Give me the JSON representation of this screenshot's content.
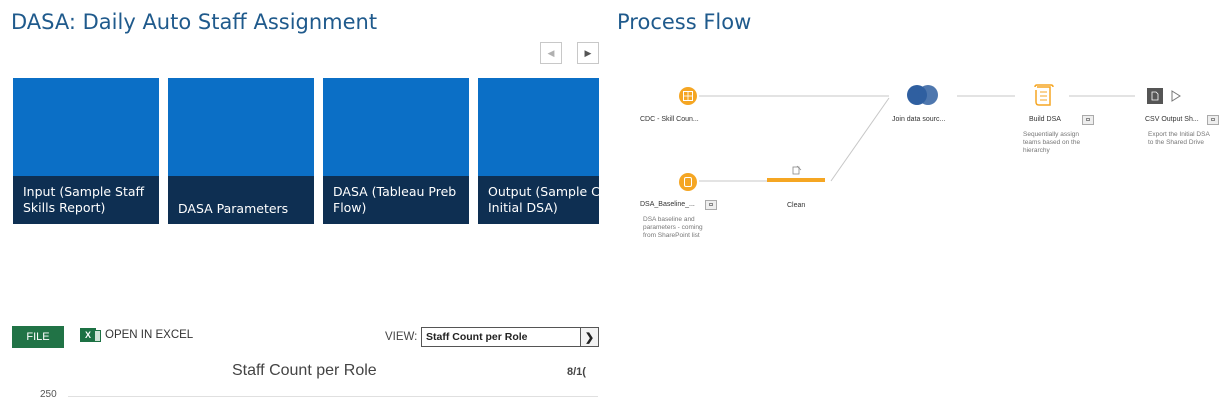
{
  "dasa": {
    "title": "DASA: Daily Auto Staff Assignment",
    "nav": {
      "prev_icon": "chevron-left-icon",
      "next_icon": "chevron-right-icon"
    },
    "tiles": [
      {
        "label": "Input (Sample Staff\nSkills Report)"
      },
      {
        "label": "DASA Parameters"
      },
      {
        "label": "DASA (Tableau Preb\nFlow)"
      },
      {
        "label": "Output (Sample CDC\nInitial DSA)"
      }
    ],
    "colors": {
      "tile": "#0b6fc6",
      "caption": "#0e2f52",
      "title": "#1f5a8c"
    }
  },
  "excel": {
    "file_label": "FILE",
    "open_label": "OPEN IN EXCEL",
    "view_label": "VIEW:",
    "view_selected": "Staff Count per Role",
    "chart_title": "Staff Count per Role",
    "date_text": "8/1(",
    "y_tick": "250",
    "colors": {
      "file": "#217346"
    }
  },
  "process_flow": {
    "title": "Process Flow",
    "nodes": {
      "cdc": {
        "label": "CDC - Skill Coun..."
      },
      "dsa_baseline": {
        "label": "DSA_Baseline_...",
        "desc": "DSA baseline and\nparameters - coming\nfrom SharePoint list"
      },
      "clean": {
        "label": "Clean"
      },
      "join": {
        "label": "Join data sourc..."
      },
      "build": {
        "label": "Build DSA",
        "desc": "Sequentially assign\nteams based on the\nhierarchy"
      },
      "csv": {
        "label": "CSV Output Sh...",
        "desc": "Export the Initial DSA\nto the Shared Drive"
      }
    },
    "colors": {
      "input": "#f5a623",
      "join": "#2f5fa0",
      "clean": "#f5a623"
    }
  }
}
